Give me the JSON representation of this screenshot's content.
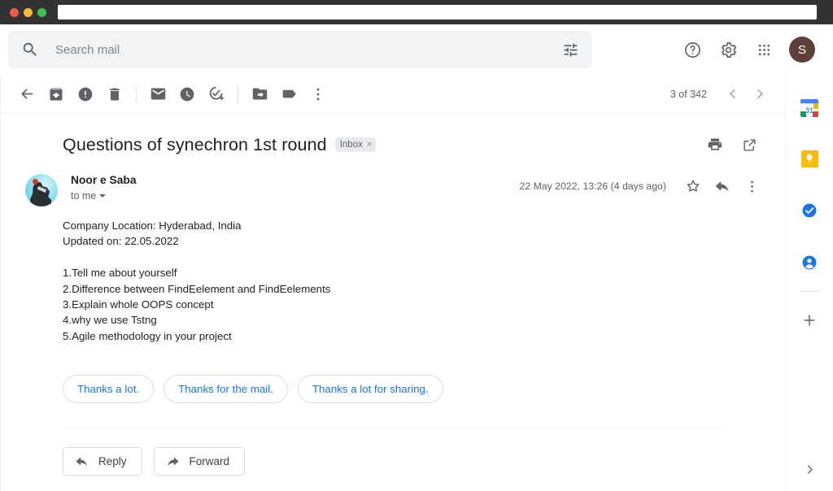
{
  "window": {
    "traffic_lights": [
      "close",
      "minimize",
      "zoom"
    ],
    "url_value": ""
  },
  "header": {
    "search": {
      "placeholder": "Search mail",
      "value": "",
      "icon": "search-icon",
      "options_icon": "tune-icon"
    },
    "actions": [
      {
        "name": "help-icon",
        "label": "Support"
      },
      {
        "name": "gear-icon",
        "label": "Settings"
      },
      {
        "name": "apps-grid-icon",
        "label": "Google apps"
      }
    ],
    "avatar_letter": "S",
    "avatar_color": "#5d4037"
  },
  "toolbar": {
    "items": [
      {
        "name": "back-icon",
        "label": "Back to Inbox"
      },
      {
        "name": "archive-icon",
        "label": "Archive"
      },
      {
        "name": "report-spam-icon",
        "label": "Report spam"
      },
      {
        "name": "delete-icon",
        "label": "Delete"
      },
      {
        "name": "mark-unread-icon",
        "label": "Mark as unread"
      },
      {
        "name": "snooze-icon",
        "label": "Snooze"
      },
      {
        "name": "add-to-tasks-icon",
        "label": "Add to Tasks"
      },
      {
        "name": "move-to-icon",
        "label": "Move to"
      },
      {
        "name": "labels-icon",
        "label": "Labels"
      },
      {
        "name": "more-icon",
        "label": "More"
      }
    ],
    "pager": {
      "count_text": "3 of 342",
      "prev_label": "Older",
      "next_label": "Newer"
    }
  },
  "message": {
    "subject": "Questions of synechron 1st round",
    "label_chip": {
      "text": "Inbox",
      "remove": "×"
    },
    "subject_actions": [
      {
        "name": "print-icon",
        "label": "Print all"
      },
      {
        "name": "open-in-new-icon",
        "label": "Open in new window"
      }
    ],
    "sender_name": "Noor e Saba",
    "recipient": "to me",
    "date": "22 May 2022, 13:26 (4 days ago)",
    "message_actions": [
      {
        "name": "star-icon",
        "label": "Not starred"
      },
      {
        "name": "reply-arrow-icon",
        "label": "Reply"
      },
      {
        "name": "more-icon",
        "label": "More"
      }
    ],
    "body": "Company Location: Hyderabad, India\nUpdated on: 22.05.2022\n\n1.Tell me about yourself\n2.Difference between FindEelement and FindEelements\n3.Explain whole OOPS concept\n4.why we use Tstng\n5.Agile methodology in your project"
  },
  "smart_replies": {
    "accent_color": "#1a73e8",
    "items": [
      {
        "label": "Thanks a lot."
      },
      {
        "label": "Thanks for the mail."
      },
      {
        "label": "Thanks a lot for sharing."
      }
    ]
  },
  "reply_bar": {
    "reply_label": "Reply",
    "forward_label": "Forward"
  },
  "side_panel": {
    "items": [
      {
        "name": "google-calendar-icon",
        "label": "Calendar",
        "badge": "31"
      },
      {
        "name": "google-keep-icon",
        "label": "Keep"
      },
      {
        "name": "google-tasks-icon",
        "label": "Tasks"
      },
      {
        "name": "google-contacts-icon",
        "label": "Contacts"
      },
      {
        "name": "add-ons-plus-icon",
        "label": "Get add-ons"
      }
    ],
    "expand_label": "Show side panel"
  }
}
